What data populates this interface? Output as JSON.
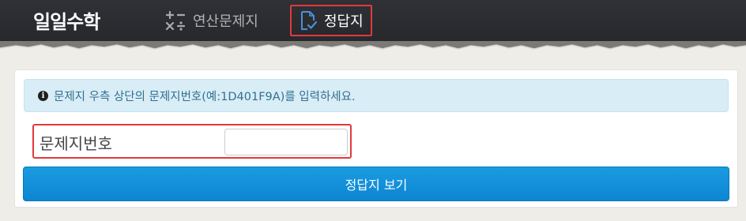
{
  "header": {
    "logo": "일일수학",
    "nav": [
      {
        "label": "연산문제지",
        "icon": "math-operators-icon"
      },
      {
        "label": "정답지",
        "icon": "document-check-icon",
        "active": true
      }
    ]
  },
  "alert": {
    "icon": "info-icon",
    "icon_glyph": "i",
    "text": "문제지 우측 상단의 문제지번호(예:1D401F9A)를 입력하세요."
  },
  "form": {
    "label": "문제지번호",
    "input_value": "",
    "input_placeholder": ""
  },
  "button": {
    "label": "정답지 보기"
  },
  "colors": {
    "header_bg": "#2b2d31",
    "highlight_border": "#e2393b",
    "alert_bg": "#d9edf7",
    "alert_text": "#31708f",
    "button_bg": "#1592d9",
    "icon_accent": "#4a90d9"
  }
}
